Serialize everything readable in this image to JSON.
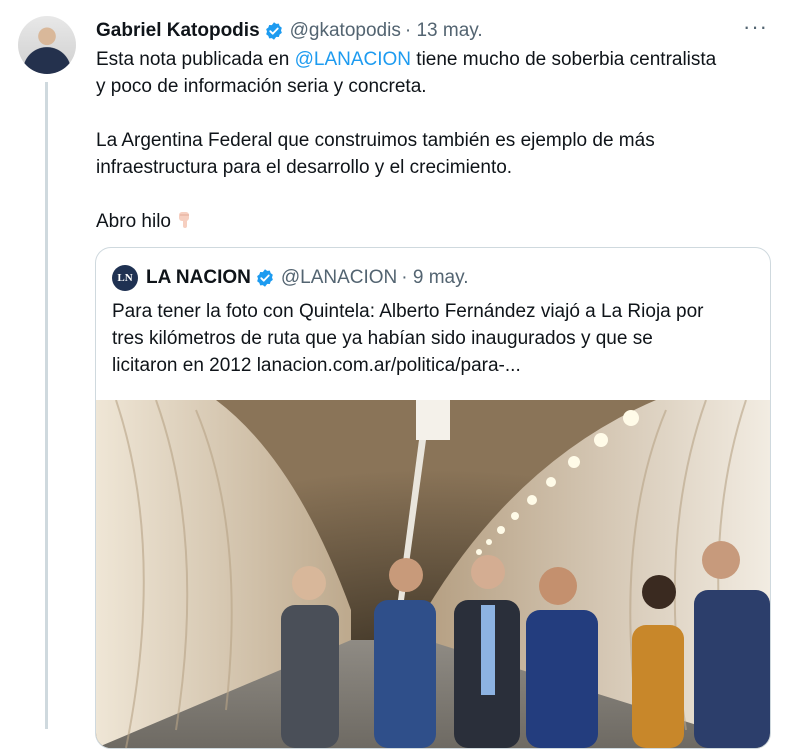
{
  "tweet": {
    "author_name": "Gabriel Katopodis",
    "author_handle": "@gkatopodis",
    "date": "· 13 may.",
    "more_label": "···",
    "line1_pre": "Esta nota publicada en ",
    "line1_mention": "@LANACION",
    "line1_post": " tiene mucho de soberbia centralista",
    "line2": "y poco de información seria y concreta.",
    "line3": "La Argentina Federal que construimos también es ejemplo de más",
    "line4": "infraestructura para el desarrollo y el crecimiento.",
    "line5": "Abro hilo",
    "emoji": "pointing-down-emoji"
  },
  "quoted": {
    "logo_text": "LN",
    "author_name": "LA NACION",
    "author_handle": "@LANACION",
    "date": "· 9 may.",
    "line1": "Para tener la foto con Quintela: Alberto Fernández viajó a La Rioja por",
    "line2": "tres kilómetros de ruta que ya habían sido inaugurados y que se",
    "line3": "licitaron en 2012 lanacion.com.ar/politica/para-...",
    "image": "tunnel-photo"
  },
  "colors": {
    "accent": "#1d9bf0",
    "secondary_text": "#536471",
    "border": "#cfd9de"
  }
}
